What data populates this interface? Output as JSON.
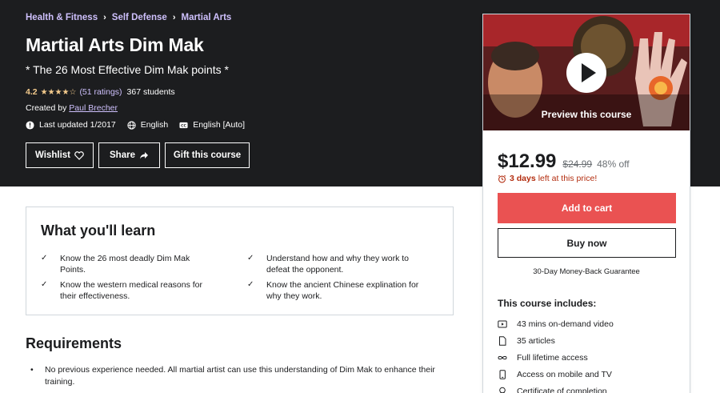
{
  "breadcrumb": [
    "Health & Fitness",
    "Self Defense",
    "Martial Arts"
  ],
  "course": {
    "title": "Martial Arts Dim Mak",
    "subtitle": "* The 26 Most Effective Dim Mak points *",
    "rating": "4.2",
    "stars_value": 4.2,
    "ratings_count": "(51 ratings)",
    "students": "367 students",
    "created_by_label": "Created by",
    "instructor": "Paul Brecher",
    "last_updated": "Last updated 1/2017",
    "language": "English",
    "captions": "English [Auto]"
  },
  "actions": {
    "wishlist": "Wishlist",
    "share": "Share",
    "gift": "Gift this course"
  },
  "sidebar": {
    "preview_label": "Preview this course",
    "price": "$12.99",
    "original_price": "$24.99",
    "discount": "48% off",
    "timer_bold": "3 days",
    "timer_rest": "left at this price!",
    "add_to_cart": "Add to cart",
    "buy_now": "Buy now",
    "guarantee": "30-Day Money-Back Guarantee",
    "includes_title": "This course includes:",
    "includes": [
      {
        "icon": "video-icon",
        "label": "43 mins on-demand video"
      },
      {
        "icon": "file-icon",
        "label": "35 articles"
      },
      {
        "icon": "infinity-icon",
        "label": "Full lifetime access"
      },
      {
        "icon": "mobile-icon",
        "label": "Access on mobile and TV"
      },
      {
        "icon": "certificate-icon",
        "label": "Certificate of completion"
      }
    ]
  },
  "learn": {
    "title": "What you'll learn",
    "items": [
      "Know the 26 most deadly Dim Mak Points.",
      "Understand how and why they work to defeat the opponent.",
      "Know the western medical reasons for their effectiveness.",
      "Know the ancient Chinese explination for why they work."
    ]
  },
  "requirements": {
    "title": "Requirements",
    "items": [
      "No previous experience needed. All martial artist can use this understanding of Dim Mak to enhance their training."
    ]
  },
  "colors": {
    "hero_bg": "#1c1d1f",
    "accent_purple": "#cec0fc",
    "star_gold": "#f3ca8c",
    "cart_red": "#ea5252",
    "timer_red": "#b32d0f"
  }
}
